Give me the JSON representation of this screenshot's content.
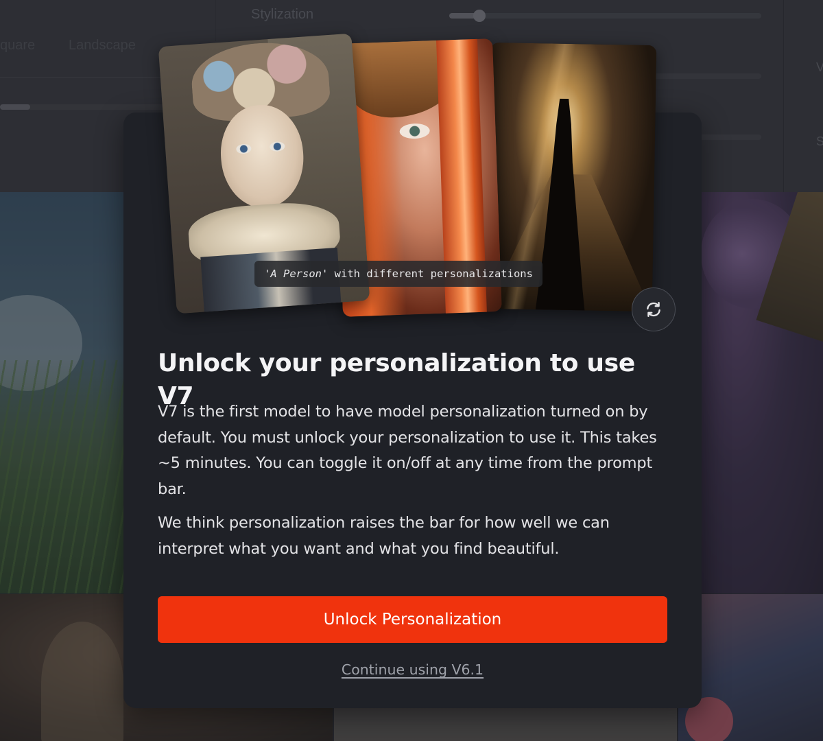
{
  "background": {
    "stylization_label": "Stylization",
    "aspect_options": [
      "quare",
      "Landscape"
    ],
    "right_edge_letters": [
      "V",
      "S"
    ]
  },
  "modal": {
    "image_caption_quoted": "'A Person'",
    "image_caption_rest": " with different personalizations",
    "title": "Unlock your personalization to use V7",
    "paragraph_1": "V7 is the first model to have model personalization turned on by default. You must unlock your personalization to use it. This takes ~5 minutes. You can toggle it on/off at any time from the prompt bar.",
    "paragraph_2": "We think personalization raises the bar for how well we can interpret what you want and what you find beautiful.",
    "primary_button": "Unlock Personalization",
    "secondary_link": "Continue using V6.1",
    "refresh_icon": "refresh-icon"
  },
  "colors": {
    "accent": "#f0330d",
    "modal_bg": "#1f2127",
    "overlay": "#2a2c33"
  }
}
